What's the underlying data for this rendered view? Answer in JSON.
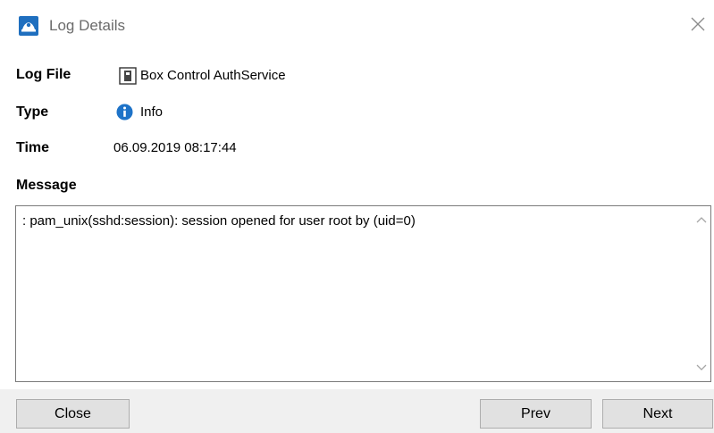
{
  "window": {
    "title": "Log Details",
    "close_icon": "close-icon",
    "app_icon": "app-icon"
  },
  "fields": {
    "log_file": {
      "label": "Log File",
      "value": "Box Control AuthService",
      "icon": "log-file-icon"
    },
    "type": {
      "label": "Type",
      "value": "Info",
      "icon": "info-icon"
    },
    "time": {
      "label": "Time",
      "value": "06.09.2019 08:17:44"
    }
  },
  "message": {
    "label": "Message",
    "text": ": pam_unix(sshd:session): session opened for user root by (uid=0)"
  },
  "buttons": {
    "close": "Close",
    "prev": "Prev",
    "next": "Next"
  },
  "colors": {
    "title_text": "#6b6b6b",
    "info_blue": "#1e73c8",
    "footer_bg": "#f0f0f0",
    "button_bg": "#e1e1e1",
    "button_border": "#adadad"
  }
}
